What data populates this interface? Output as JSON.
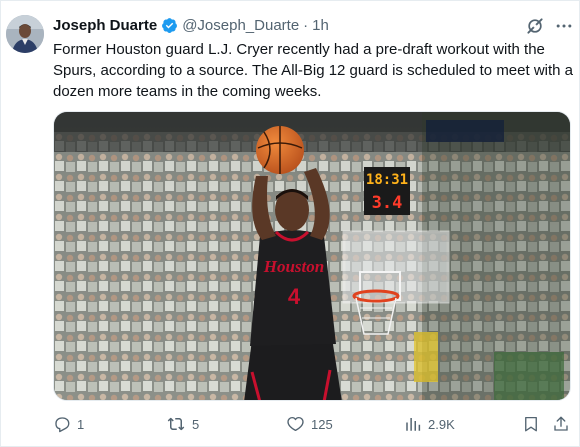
{
  "author": {
    "display_name": "Joseph Duarte",
    "handle": "@Joseph_Duarte",
    "separator": "·",
    "time": "1h",
    "verified": true,
    "avatar_icon": "user-avatar"
  },
  "tweet": {
    "text": "Former Houston guard L.J. Cryer recently had a pre-draft workout with the Spurs, according to a source. The All-Big 12 guard is scheduled to meet with a dozen more teams in the coming weeks."
  },
  "media": {
    "type": "photo",
    "jersey_team": "Houston",
    "jersey_number": "4",
    "scoreboard_top": "18:31",
    "scoreboard_bottom": "3.4"
  },
  "actions": {
    "reply_count": "1",
    "repost_count": "5",
    "like_count": "125",
    "views_count": "2.9K"
  },
  "icons": {
    "verified": "verified-badge-icon",
    "grok": "grok-icon",
    "more": "more-icon",
    "reply": "reply-icon",
    "repost": "repost-icon",
    "like": "heart-icon",
    "views": "views-icon",
    "bookmark": "bookmark-icon",
    "share": "share-icon"
  },
  "colors": {
    "text_primary": "#0f1419",
    "text_secondary": "#536471",
    "verified_blue": "#1d9bf0",
    "border": "#e6ecf0"
  }
}
